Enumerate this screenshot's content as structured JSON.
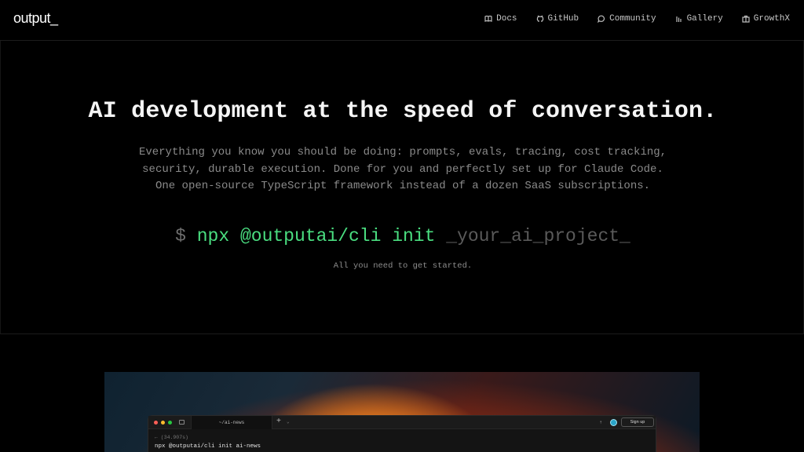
{
  "brand": {
    "logo": "output_"
  },
  "nav": [
    {
      "label": "Docs",
      "icon": "book-icon"
    },
    {
      "label": "GitHub",
      "icon": "github-icon"
    },
    {
      "label": "Community",
      "icon": "chat-icon"
    },
    {
      "label": "Gallery",
      "icon": "gallery-icon"
    },
    {
      "label": "GrowthX",
      "icon": "briefcase-icon"
    }
  ],
  "hero": {
    "headline": "AI development at the speed of conversation.",
    "sub": [
      "Everything you know you should be doing: prompts, evals, tracing, cost tracking,",
      "security, durable execution. Done for you and perfectly set up for Claude Code.",
      "One open-source TypeScript framework instead of a dozen SaaS subscriptions."
    ],
    "command": {
      "prompt": "$",
      "cmd": "npx @outputai/cli init",
      "placeholder": "_your_ai_project_"
    },
    "hint": "All you need to get started."
  },
  "preview": {
    "tab_title": "~/ai-news",
    "plus": "+",
    "chevron": "⌄",
    "signup_label": "Sign up",
    "term_lines": [
      "← (34.907s)",
      "npx @outputai/cli init ai-news"
    ],
    "colors": {
      "red": "#ff5f57",
      "yellow": "#febc2e",
      "green": "#28c840",
      "accent_green": "#4ade80"
    }
  }
}
